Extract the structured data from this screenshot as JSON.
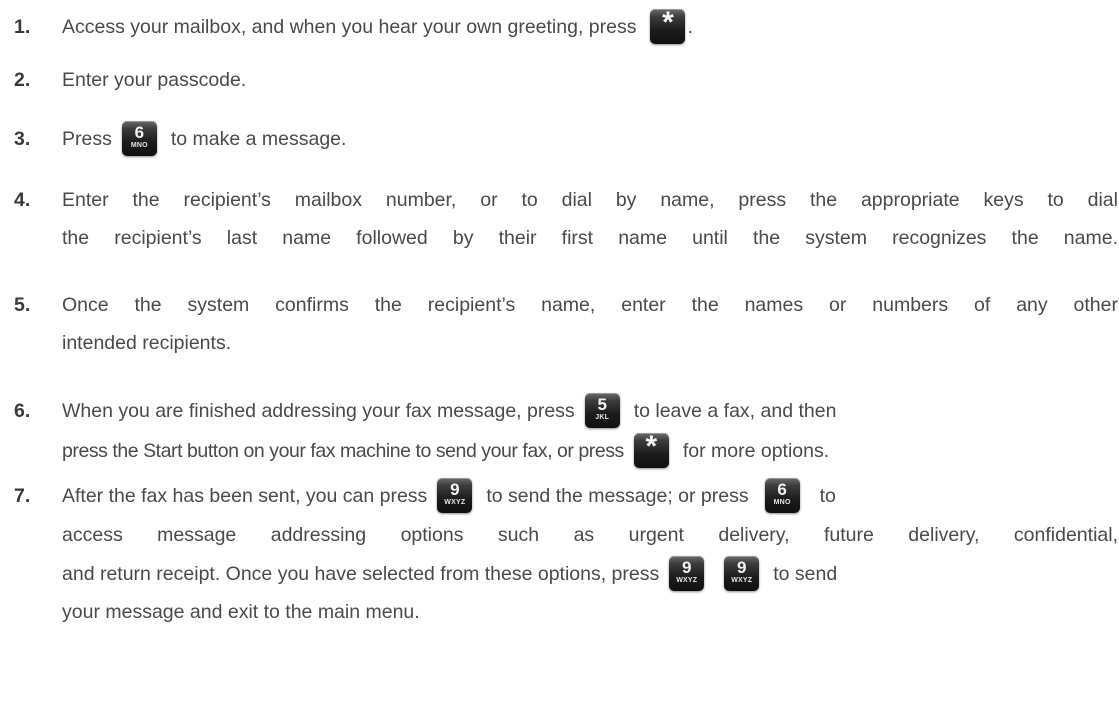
{
  "steps": [
    {
      "num": "1.",
      "parts": {
        "a": "Access your mailbox, and when you hear your own greeting, press",
        "b": "."
      },
      "keys": [
        {
          "digit": "*",
          "letters": ""
        }
      ]
    },
    {
      "num": "2.",
      "text": "Enter your passcode."
    },
    {
      "num": "3.",
      "parts": {
        "a": "Press",
        "b": "to make a message."
      },
      "keys": [
        {
          "digit": "6",
          "letters": "MNO"
        }
      ]
    },
    {
      "num": "4.",
      "lines": [
        "Enter the recipient’s mailbox number, or to dial by name, press the appropriate keys to dial",
        "the recipient’s last name followed by their first name until the system recognizes the name."
      ]
    },
    {
      "num": "5.",
      "lines": [
        "Once the system confirms the recipient’s name, enter the names or numbers of any other",
        "intended recipients."
      ]
    },
    {
      "num": "6.",
      "parts": {
        "a": "When you are finished addressing your fax message, press",
        "b": "to leave a fax, and then",
        "c": "press the Start button on your fax machine to send your fax, or press",
        "d": "for more options."
      },
      "keys": [
        {
          "digit": "5",
          "letters": "JKL"
        },
        {
          "digit": "*",
          "letters": ""
        }
      ]
    },
    {
      "num": "7.",
      "parts": {
        "a": "After the fax has been sent, you can press",
        "b": "to send the message; or press",
        "c": "to",
        "d": "access message addressing options such as urgent delivery, future delivery, confidential,",
        "e": "and return receipt. Once you have selected from these options, press",
        "f": "to send",
        "g": "your message and exit to the main menu."
      },
      "keys": [
        {
          "digit": "9",
          "letters": "WXYZ"
        },
        {
          "digit": "6",
          "letters": "MNO"
        },
        {
          "digit": "9",
          "letters": "WXYZ"
        },
        {
          "digit": "9",
          "letters": "WXYZ"
        }
      ]
    }
  ]
}
